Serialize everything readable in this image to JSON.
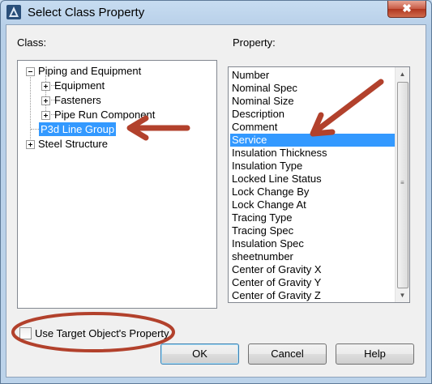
{
  "window": {
    "title": "Select Class Property",
    "close_glyph": "✖"
  },
  "class_panel": {
    "label": "Class:",
    "tree": [
      {
        "label": "Piping and Equipment",
        "expanded": true
      },
      {
        "label": "Equipment",
        "expanded": false
      },
      {
        "label": "Fasteners",
        "expanded": false
      },
      {
        "label": "Pipe Run Component",
        "expanded": false
      },
      {
        "label": "P3d Line Group",
        "selected": true
      },
      {
        "label": "Steel Structure",
        "expanded": false
      }
    ]
  },
  "property_panel": {
    "label": "Property:",
    "items": [
      "Number",
      "Nominal Spec",
      "Nominal Size",
      "Description",
      "Comment",
      "Service",
      "Insulation Thickness",
      "Insulation Type",
      "Locked Line Status",
      "Lock Change By",
      "Lock Change At",
      "Tracing Type",
      "Tracing Spec",
      "Insulation Spec",
      "sheetnumber",
      "Center of Gravity X",
      "Center of Gravity Y",
      "Center of Gravity Z"
    ],
    "selected": "Service"
  },
  "use_target": {
    "label": "Use Target Object's Property",
    "checked": false
  },
  "buttons": {
    "ok": "OK",
    "cancel": "Cancel",
    "help": "Help"
  },
  "colors": {
    "selection": "#3399ff",
    "annotation": "#b2412c"
  }
}
